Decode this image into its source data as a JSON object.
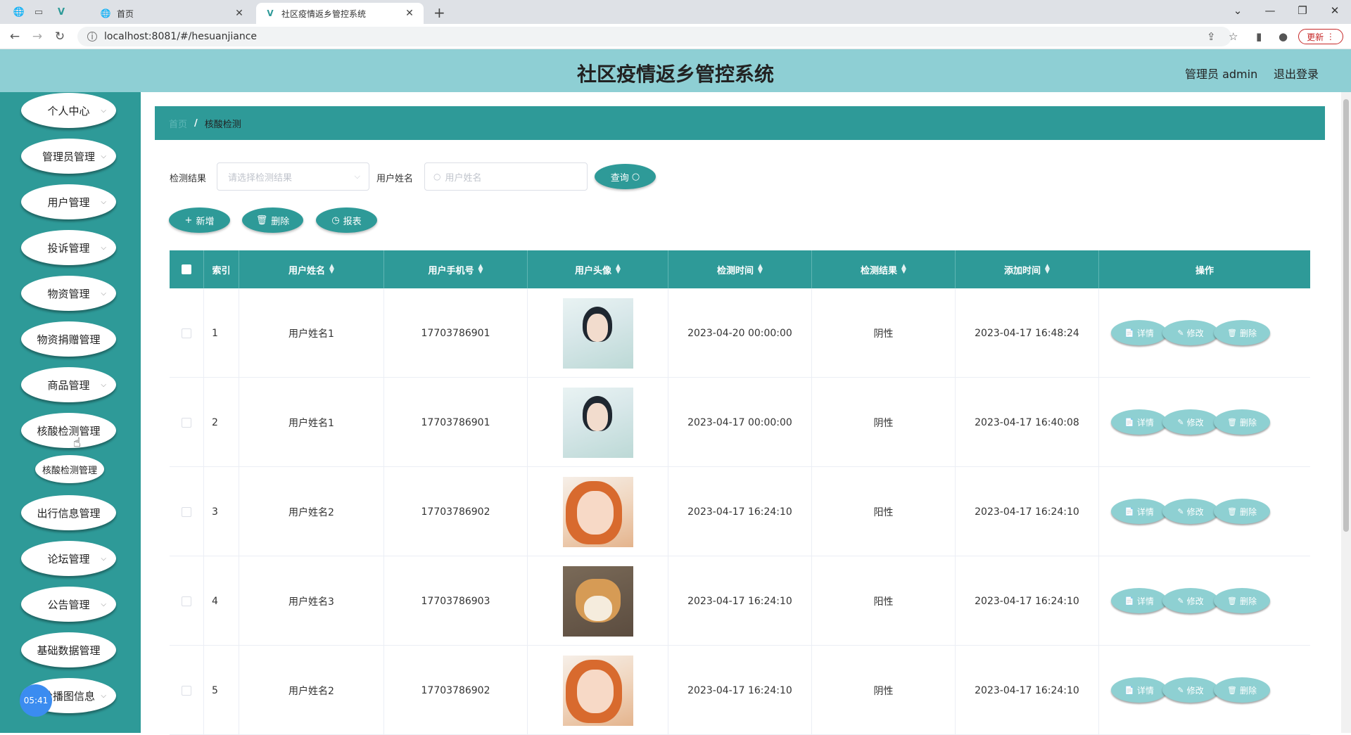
{
  "browser": {
    "inactive_tab_title": "首页",
    "active_tab_title": "社区疫情返乡管控系统",
    "url": "localhost:8081/#/hesuanjiance",
    "update_label": "更新"
  },
  "header": {
    "title": "社区疫情返乡管控系统",
    "user": "管理员 admin",
    "logout": "退出登录"
  },
  "sidebar": {
    "items": [
      {
        "label": "个人中心",
        "arrow": true
      },
      {
        "label": "管理员管理",
        "arrow": true
      },
      {
        "label": "用户管理",
        "arrow": true
      },
      {
        "label": "投诉管理",
        "arrow": true
      },
      {
        "label": "物资管理",
        "arrow": true
      },
      {
        "label": "物资捐赠管理",
        "arrow": false
      },
      {
        "label": "商品管理",
        "arrow": true
      },
      {
        "label": "核酸检测管理",
        "arrow": false
      },
      {
        "label": "出行信息管理",
        "arrow": false
      },
      {
        "label": "论坛管理",
        "arrow": true
      },
      {
        "label": "公告管理",
        "arrow": true
      },
      {
        "label": "基础数据管理",
        "arrow": false
      },
      {
        "label": "轮播图信息",
        "arrow": true
      }
    ],
    "submenu_label": "核酸检测管理",
    "clock": "05:41"
  },
  "breadcrumb": {
    "home": "首页",
    "separator": "/",
    "current": "核酸检测"
  },
  "search": {
    "result_label": "检测结果",
    "result_placeholder": "请选择检测结果",
    "name_label": "用户姓名",
    "name_placeholder": "用户姓名",
    "query_label": "查询"
  },
  "actions": {
    "add": "新增",
    "delete": "删除",
    "report": "报表"
  },
  "table": {
    "columns": [
      "索引",
      "用户姓名",
      "用户手机号",
      "用户头像",
      "检测时间",
      "检测结果",
      "添加时间",
      "操作"
    ],
    "rows": [
      {
        "index": "1",
        "name": "用户姓名1",
        "phone": "17703786901",
        "avatar": "woman-portrait",
        "test_time": "2023-04-20 00:00:00",
        "result": "阴性",
        "add_time": "2023-04-17 16:48:24"
      },
      {
        "index": "2",
        "name": "用户姓名1",
        "phone": "17703786901",
        "avatar": "woman-portrait",
        "test_time": "2023-04-17 00:00:00",
        "result": "阴性",
        "add_time": "2023-04-17 16:40:08"
      },
      {
        "index": "3",
        "name": "用户姓名2",
        "phone": "17703786902",
        "avatar": "smiling-woman",
        "test_time": "2023-04-17 16:24:10",
        "result": "阳性",
        "add_time": "2023-04-17 16:24:10"
      },
      {
        "index": "4",
        "name": "用户姓名3",
        "phone": "17703786903",
        "avatar": "shiba-dog",
        "test_time": "2023-04-17 16:24:10",
        "result": "阳性",
        "add_time": "2023-04-17 16:24:10"
      },
      {
        "index": "5",
        "name": "用户姓名2",
        "phone": "17703786902",
        "avatar": "smiling-woman",
        "test_time": "2023-04-17 16:24:10",
        "result": "阴性",
        "add_time": "2023-04-17 16:24:10"
      }
    ],
    "row_actions": {
      "detail": "详情",
      "edit": "修改",
      "delete": "删除"
    }
  },
  "colors": {
    "teal": "#2e9a98",
    "header_bg": "#8ecfd4",
    "op_button": "#8ed0d2"
  }
}
